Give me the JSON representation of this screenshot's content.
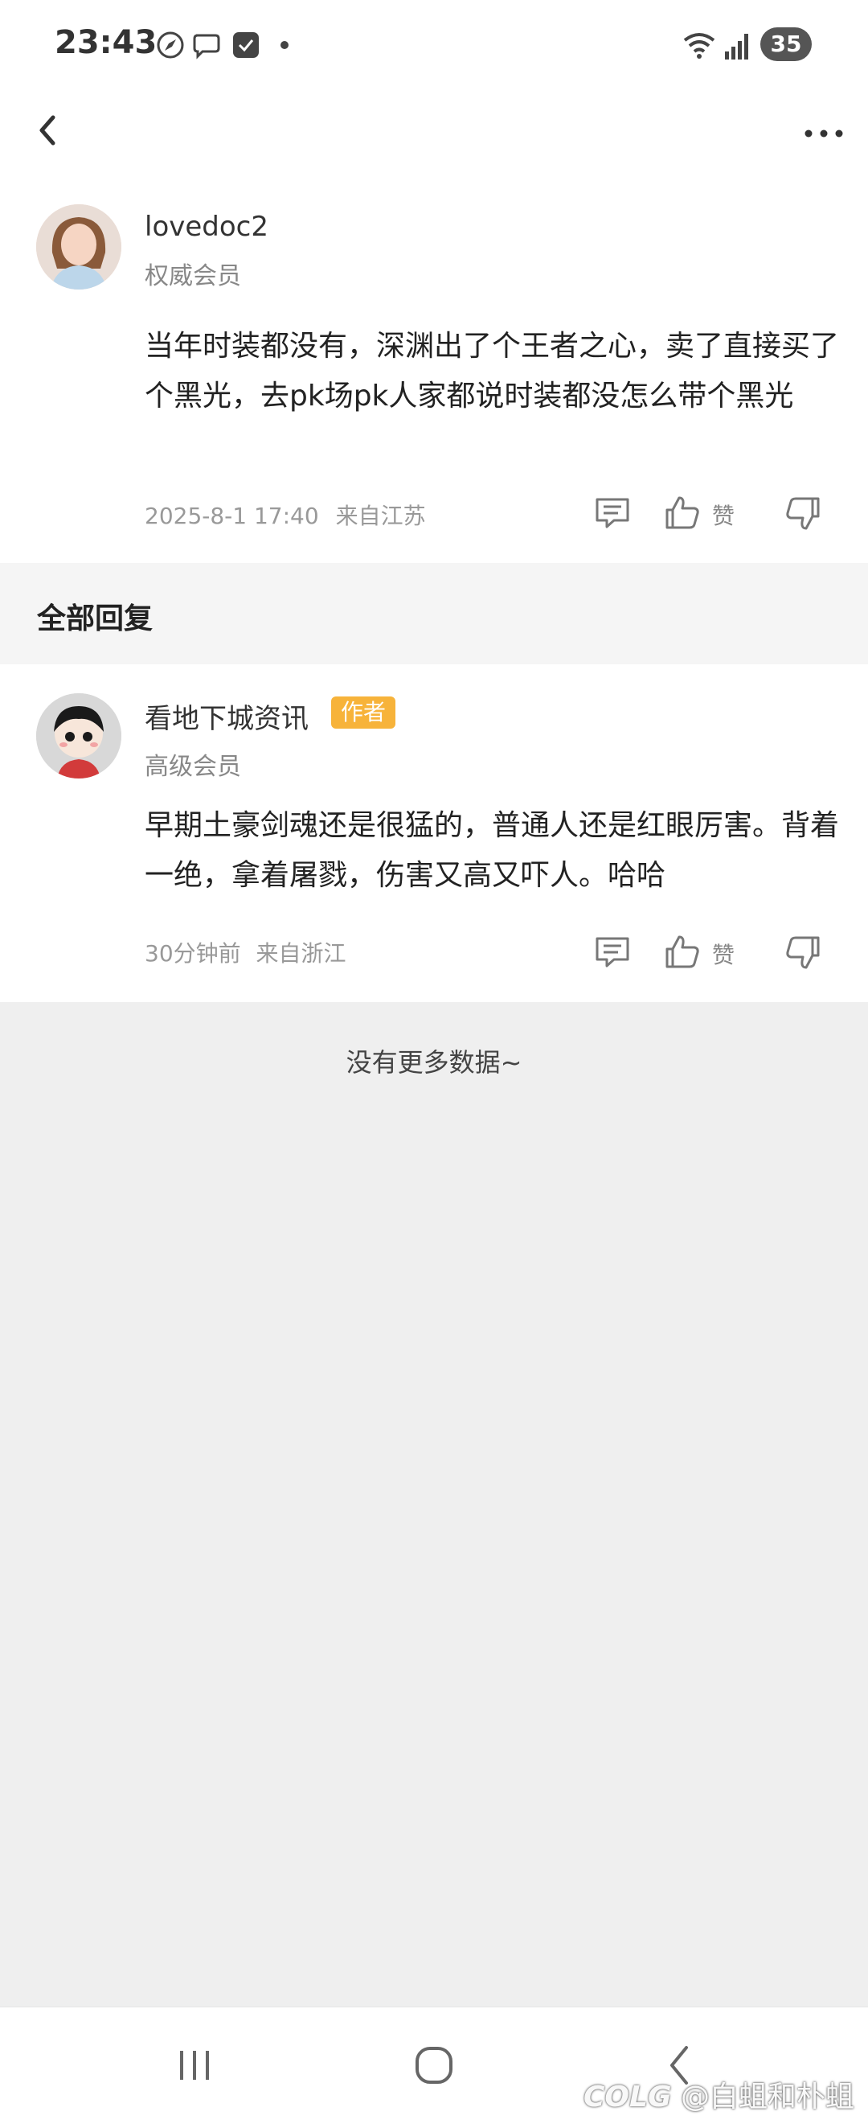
{
  "status_bar": {
    "time": "23:43",
    "battery": "35"
  },
  "post": {
    "username": "lovedoc2",
    "role": "权威会员",
    "content": "当年时装都没有，深渊出了个王者之心，卖了直接买了个黑光，去pk场pk人家都说时装都没怎么带个黑光",
    "date": "2025-8-1 17:40",
    "location": "来自江苏",
    "like_label": "赞"
  },
  "section": {
    "title": "全部回复"
  },
  "reply": {
    "username": "看地下城资讯",
    "author_tag": "作者",
    "role": "高级会员",
    "content": "早期土豪剑魂还是很猛的，普通人还是红眼厉害。背着一绝，拿着屠戮，伤害又高又吓人。哈哈",
    "time": "30分钟前",
    "location": "来自浙江",
    "like_label": "赞"
  },
  "footer": {
    "no_more": "没有更多数据~"
  },
  "watermark": {
    "logo": "COLG",
    "handle": "@白蛆和朴蛆"
  },
  "colors": {
    "author_tag": "#f7b33a",
    "page_bg": "#efefef"
  }
}
